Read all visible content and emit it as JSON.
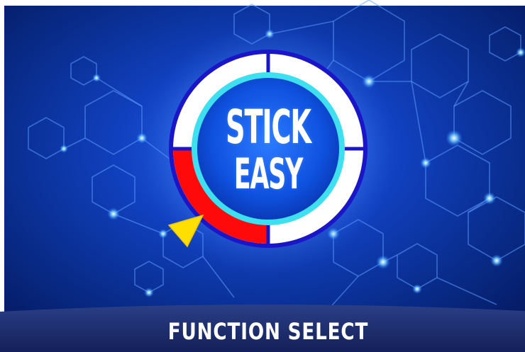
{
  "game": {
    "logo_line_1": "STICK",
    "logo_line_2": "EASY",
    "footer_label": "FUNCTION SELECT"
  },
  "dial": {
    "segments": [
      "top-right",
      "right",
      "bottom-right",
      "top-left",
      "left-active"
    ],
    "active_segment": "left-active",
    "pointer": "yellow-triangle"
  },
  "colors": {
    "background_deep": "#04134a",
    "background_glow": "#1f5ce8",
    "dial_outer_ring": "#1a16c8",
    "dial_inner_ring": "#3ee0f0",
    "dial_segment": "#ffffff",
    "dial_active_segment": "#ff0a0a",
    "pointer": "#ffdf00",
    "footer_bar": "#1b2c6e",
    "text": "#ffffff"
  },
  "icons": {
    "pointer": "triangle-pointer-icon",
    "decor": "hexagon-network-icon"
  }
}
